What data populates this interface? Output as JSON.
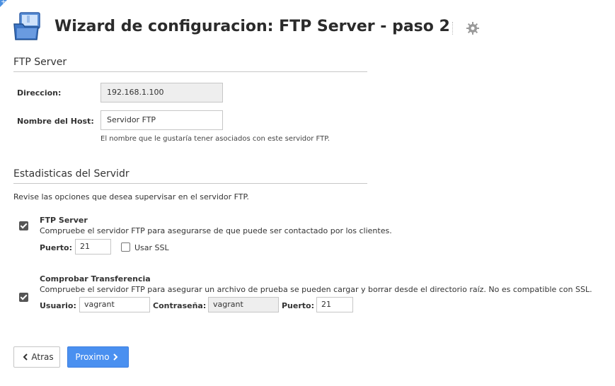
{
  "header": {
    "title": "Wizard de configuracion: FTP Server - paso 2",
    "app_icon": "folder-network-icon",
    "settings_icon": "gear-icon"
  },
  "server_section": {
    "title": "FTP Server",
    "address_label": "Direccion:",
    "address_value": "192.168.1.100",
    "hostname_label": "Nombre del Host:",
    "hostname_value": "Servidor FTP",
    "hostname_help": "El nombre que le gustaría tener asociados con este servidor FTP."
  },
  "stats_section": {
    "title": "Estadisticas del Servidr",
    "description": "Revise las opciones que desea supervisar en el servidor FTP.",
    "ftp_check": {
      "checked": true,
      "title": "FTP Server",
      "description": "Compruebe el servidor FTP para asegurarse de que puede ser contactado por los clientes.",
      "port_label": "Puerto:",
      "port_value": "21",
      "ssl_label": "Usar SSL",
      "ssl_checked": false
    },
    "transfer_check": {
      "checked": true,
      "title": "Comprobar Transferencia",
      "description": "Compruebe el servidor FTP para asegurar un archivo de prueba se pueden cargar y borrar desde el directorio raíz. No es compatible con SSL.",
      "user_label": "Usuario:",
      "user_value": "vagrant",
      "password_label": "Contraseña:",
      "password_value": "vagrant",
      "port_label": "Puerto:",
      "port_value": "21"
    }
  },
  "footer": {
    "back_label": "Atras",
    "next_label": "Proximo"
  },
  "colors": {
    "primary": "#4a90f0",
    "readonly_bg": "#eeeeee",
    "rule": "#c8c8c8"
  }
}
